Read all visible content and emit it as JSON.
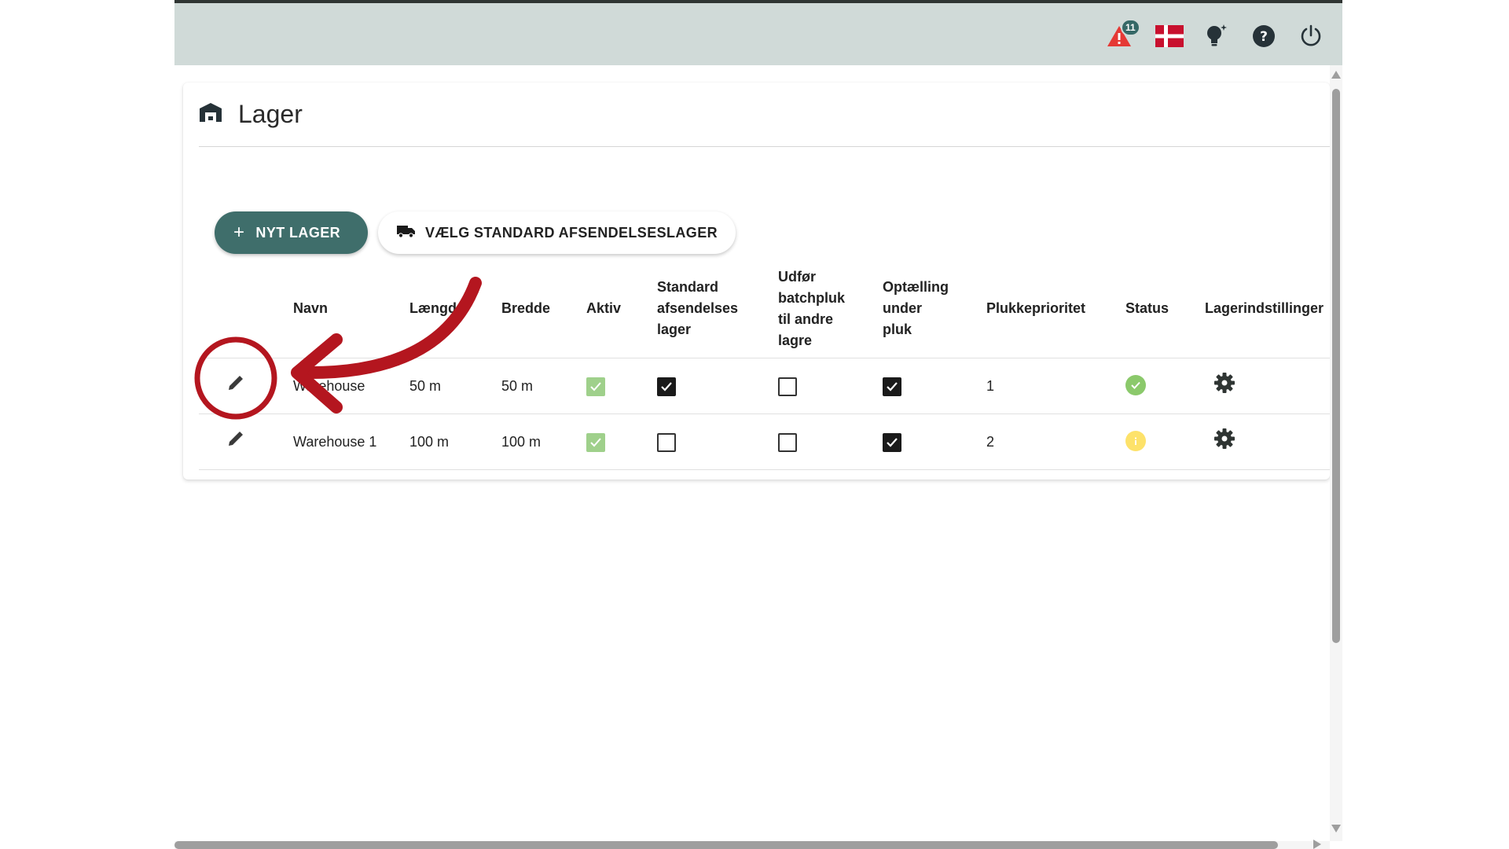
{
  "topbar": {
    "notification_count": "11",
    "icons": [
      "warning-icon",
      "danish-flag-icon",
      "lightbulb-icon",
      "help-icon",
      "power-icon"
    ]
  },
  "page": {
    "title": "Lager"
  },
  "buttons": {
    "new_warehouse": "NYT LAGER",
    "default_shipping": "VÆLG STANDARD AFSENDELSESLAGER"
  },
  "table": {
    "headers": {
      "name": "Navn",
      "length": "Længde",
      "width": "Bredde",
      "active": "Aktiv",
      "default_shipping_line1": "Standard",
      "default_shipping_line2": "afsendelses",
      "default_shipping_line3": "lager",
      "batch_line1": "Udfør",
      "batch_line2": "batchpluk",
      "batch_line3": "til andre",
      "batch_line4": "lagre",
      "count_line1": "Optælling",
      "count_line2": "under",
      "count_line3": "pluk",
      "priority": "Plukkeprioritet",
      "status": "Status",
      "settings": "Lagerindstillinger"
    },
    "rows": [
      {
        "name": "Warehouse",
        "length": "50 m",
        "width": "50 m",
        "active": true,
        "default_shipping": true,
        "batch": false,
        "count": true,
        "priority": "1",
        "status": "ok"
      },
      {
        "name": "Warehouse 1",
        "length": "100 m",
        "width": "100 m",
        "active": true,
        "default_shipping": false,
        "batch": false,
        "count": true,
        "priority": "2",
        "status": "warning"
      }
    ]
  },
  "colors": {
    "topbar_bg": "#d0dad8",
    "primary": "#3f6e6b",
    "active_green": "#9fd08b",
    "status_ok": "#8bc96b",
    "status_warning": "#fde26a",
    "annotation_red": "#b4161f",
    "warning_red": "#e53935"
  }
}
